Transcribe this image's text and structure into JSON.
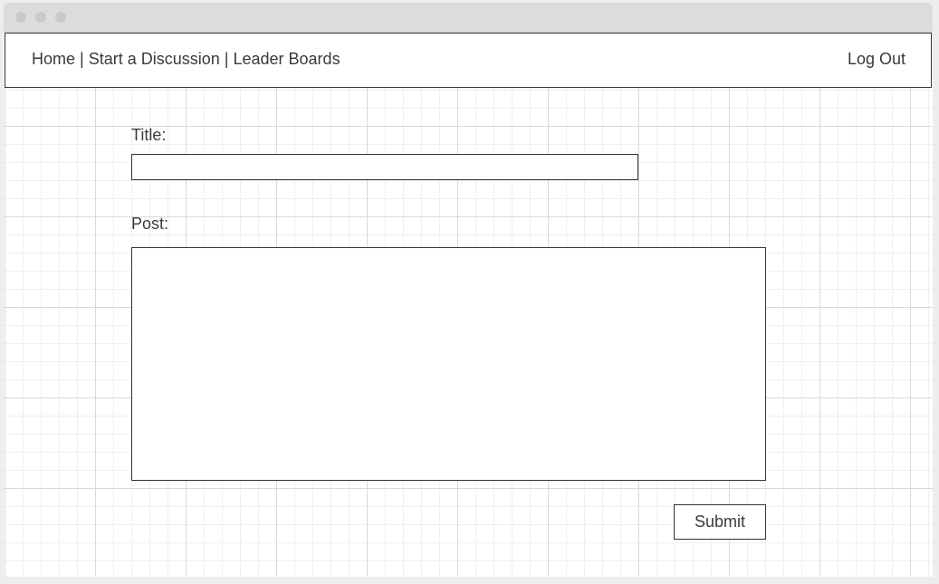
{
  "nav": {
    "links": [
      "Home",
      "Start a Discussion",
      "Leader Boards"
    ],
    "separator": "|",
    "logout_label": "Log Out"
  },
  "form": {
    "title_label": "Title:",
    "title_value": "",
    "post_label": "Post:",
    "post_value": "",
    "submit_label": "Submit"
  },
  "colors": {
    "border": "#333333",
    "text": "#3a3a3a",
    "titlebar": "#dcdcdc",
    "grid": "#d9d9d9"
  }
}
